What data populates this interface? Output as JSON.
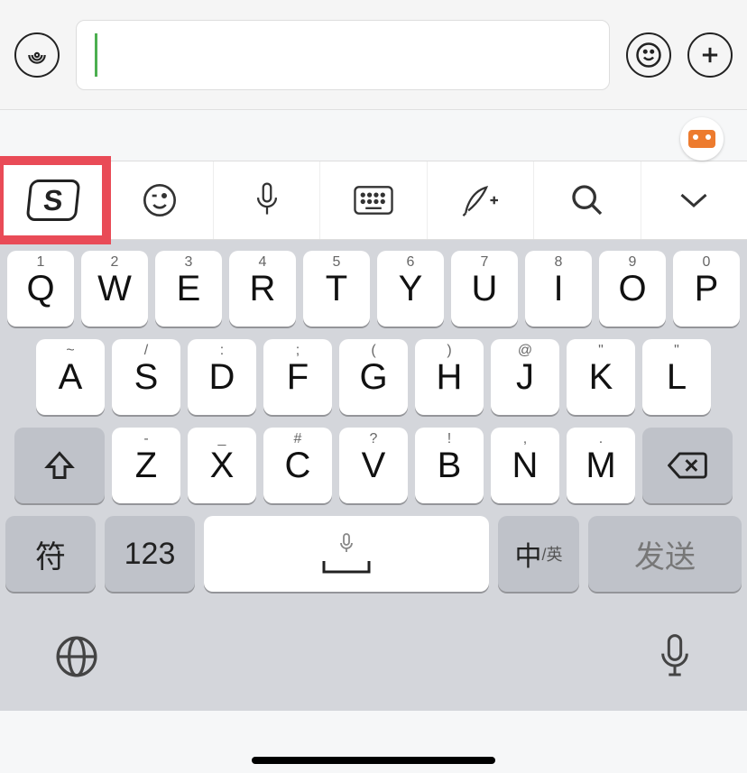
{
  "chat": {
    "input_value": "",
    "input_placeholder": ""
  },
  "toolbar": {
    "items": [
      {
        "id": "sogou",
        "label": "S"
      },
      {
        "id": "emoji"
      },
      {
        "id": "voice"
      },
      {
        "id": "keyboard"
      },
      {
        "id": "handwriting"
      },
      {
        "id": "search"
      },
      {
        "id": "collapse"
      }
    ]
  },
  "keyboard": {
    "row1": [
      {
        "main": "Q",
        "sec": "1"
      },
      {
        "main": "W",
        "sec": "2"
      },
      {
        "main": "E",
        "sec": "3"
      },
      {
        "main": "R",
        "sec": "4"
      },
      {
        "main": "T",
        "sec": "5"
      },
      {
        "main": "Y",
        "sec": "6"
      },
      {
        "main": "U",
        "sec": "7"
      },
      {
        "main": "I",
        "sec": "8"
      },
      {
        "main": "O",
        "sec": "9"
      },
      {
        "main": "P",
        "sec": "0"
      }
    ],
    "row2": [
      {
        "main": "A",
        "sec": "~"
      },
      {
        "main": "S",
        "sec": "/"
      },
      {
        "main": "D",
        "sec": ":"
      },
      {
        "main": "F",
        "sec": ";"
      },
      {
        "main": "G",
        "sec": "("
      },
      {
        "main": "H",
        "sec": ")"
      },
      {
        "main": "J",
        "sec": "@"
      },
      {
        "main": "K",
        "sec": "\""
      },
      {
        "main": "L",
        "sec": "\""
      }
    ],
    "row3": [
      {
        "main": "Z",
        "sec": "-"
      },
      {
        "main": "X",
        "sec": "_"
      },
      {
        "main": "C",
        "sec": "#"
      },
      {
        "main": "V",
        "sec": "?"
      },
      {
        "main": "B",
        "sec": "!"
      },
      {
        "main": "N",
        "sec": ","
      },
      {
        "main": "M",
        "sec": "."
      }
    ],
    "symbols_label": "符",
    "numbers_label": "123",
    "lang_main": "中",
    "lang_sub": "/英",
    "send_label": "发送"
  }
}
